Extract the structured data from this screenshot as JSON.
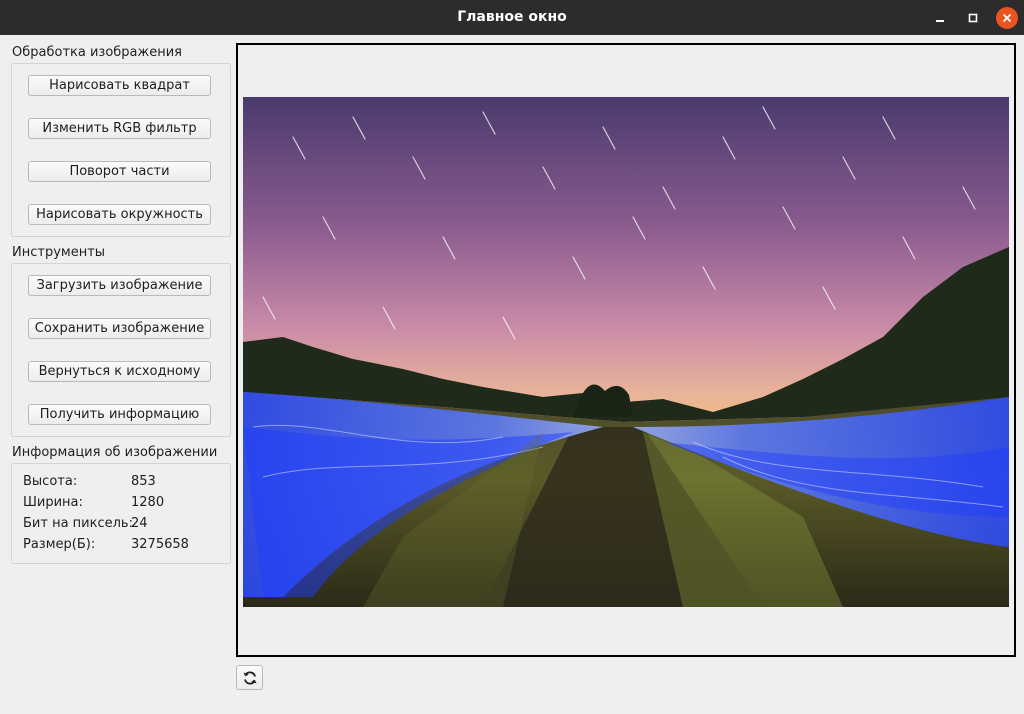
{
  "window": {
    "title": "Главное окно"
  },
  "processing": {
    "title": "Обработка изображения",
    "buttons": [
      "Нарисовать квадрат",
      "Изменить RGB фильтр",
      "Поворот части",
      "Нарисовать окружность"
    ]
  },
  "tools": {
    "title": "Инструменты",
    "buttons": [
      "Загрузить изображение",
      "Сохранить изображение",
      "Вернуться к исходному",
      "Получить информацию"
    ]
  },
  "info": {
    "title": "Информация об изображении",
    "rows": [
      {
        "label": "Высота:",
        "value": "853"
      },
      {
        "label": "Ширина:",
        "value": "1280"
      },
      {
        "label": "Бит на пиксель:",
        "value": "24"
      },
      {
        "label": "Размер(Б):",
        "value": "3275658"
      }
    ]
  },
  "icons": {
    "minimize": "minimize-icon",
    "maximize": "maximize-icon",
    "close": "close-icon",
    "refresh": "refresh-icon"
  },
  "colors": {
    "titlebar": "#2c2c2c",
    "close_button": "#e95420",
    "background": "#efefef"
  }
}
